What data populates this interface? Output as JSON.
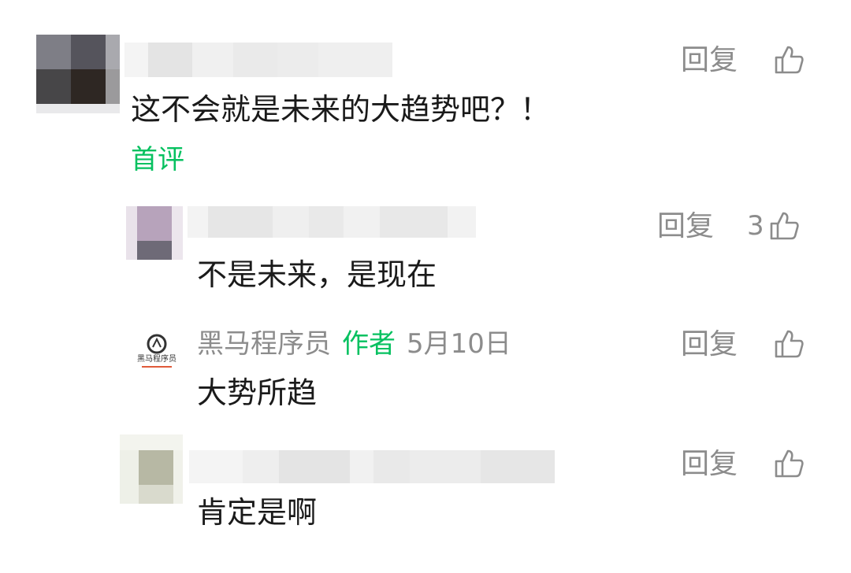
{
  "comments": [
    {
      "text": "这不会就是未来的大趋势吧？！",
      "reply_label": "回复",
      "badge": "首评"
    },
    {
      "text": "不是未来，是现在",
      "reply_label": "回复",
      "like_count": "3"
    },
    {
      "author": "黑马程序员",
      "author_tag": "作者",
      "date": "5月10日",
      "text": "大势所趋",
      "reply_label": "回复",
      "logo_text": "黑马程序员"
    },
    {
      "text": "肯定是啊",
      "reply_label": "回复"
    }
  ],
  "colors": {
    "accent_green": "#07c160",
    "meta_gray": "#8c8c8c",
    "text": "#1a1a1a"
  },
  "icons": {
    "like": "thumbs-up-icon"
  }
}
